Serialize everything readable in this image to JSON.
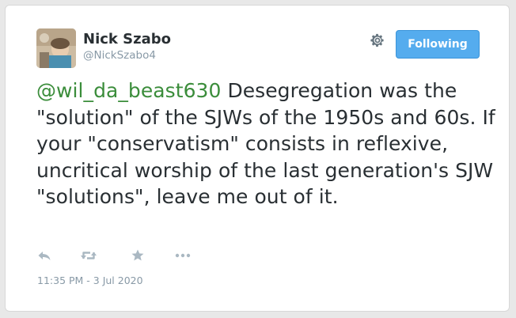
{
  "user": {
    "display_name": "Nick Szabo",
    "handle": "@NickSzabo4"
  },
  "follow_button": {
    "label": "Following"
  },
  "tweet": {
    "mention": "@wil_da_beast630",
    "text": " Desegregation was the \"solution\" of the SJWs of the 1950s and 60s. If your \"conservatism\" consists in reflexive, uncritical worship of the last generation's SJW \"solutions\", leave me out of it.",
    "timestamp": "11:35 PM - 3 Jul 2020"
  },
  "actions": {
    "icons": [
      "reply-icon",
      "retweet-icon",
      "like-icon",
      "more-icon"
    ]
  },
  "colors": {
    "follow_bg": "#55acee",
    "mention": "#3b8d3b",
    "text": "#292f33",
    "muted": "#8899a6"
  }
}
